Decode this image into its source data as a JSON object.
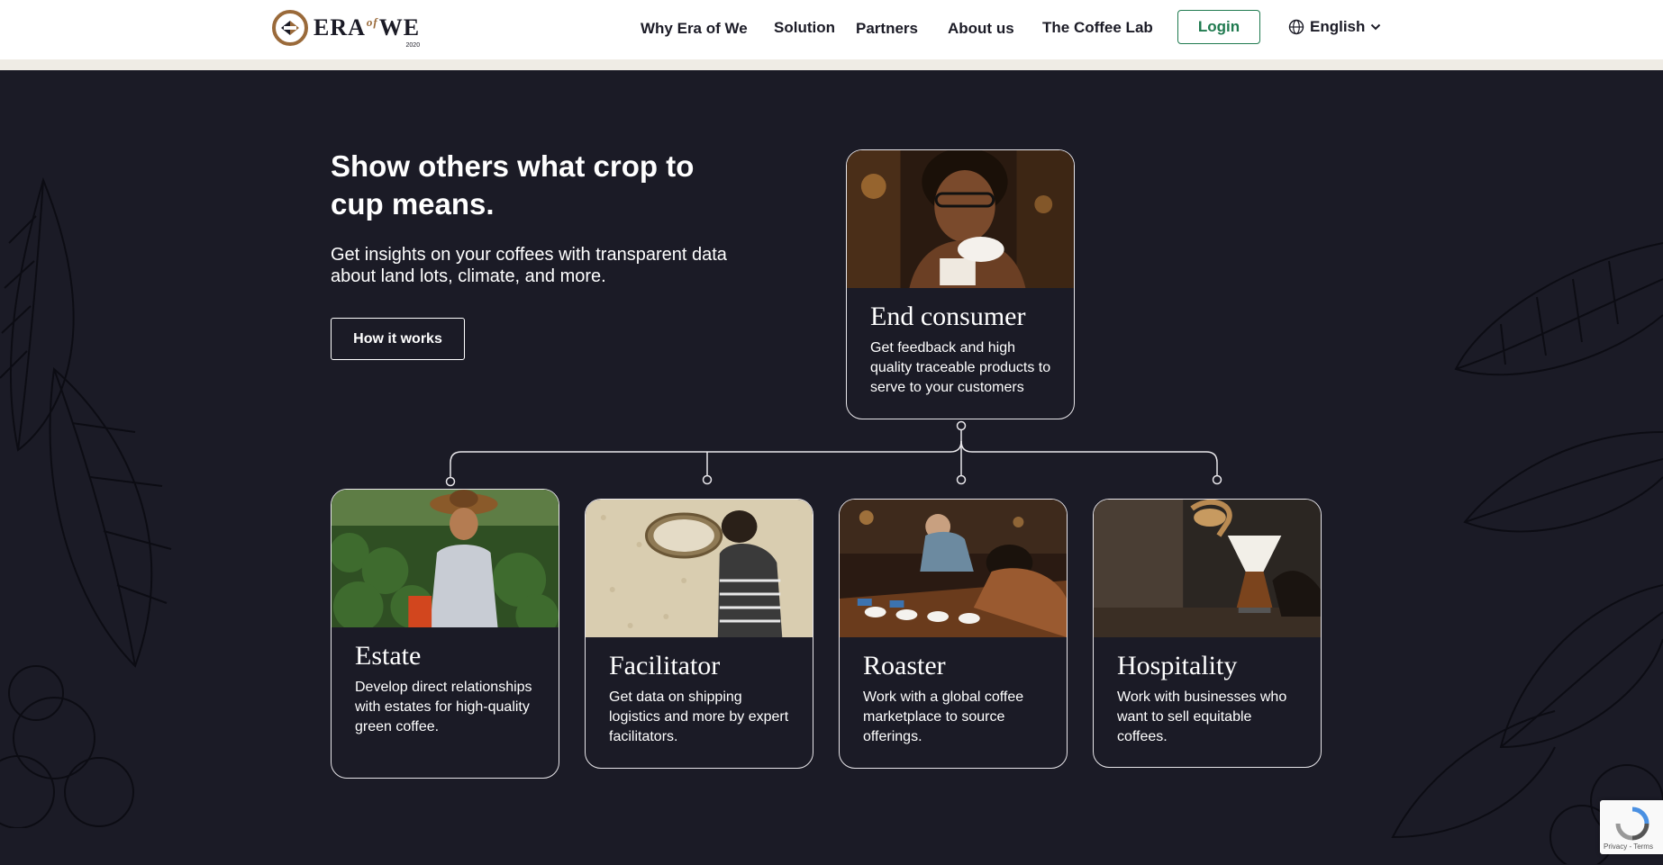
{
  "header": {
    "logo": {
      "main": "ERA",
      "of": "of",
      "we": "WE",
      "year": "2020"
    },
    "nav": [
      "Why Era of We",
      "Solution",
      "Partners",
      "About us",
      "The Coffee Lab"
    ],
    "login_label": "Login",
    "language": "English"
  },
  "hero": {
    "title": "Show others what crop to cup means.",
    "subtitle": "Get insights on your coffees with transparent data about land lots, climate, and more.",
    "button_label": "How it works"
  },
  "cards": {
    "end_consumer": {
      "title": "End consumer",
      "desc": "Get feedback and high quality traceable products to serve to your customers",
      "photo": "woman-with-coffee-cup-photo"
    },
    "estate": {
      "title": "Estate",
      "desc": "Develop direct relationships with estates for high-quality green coffee.",
      "photo": "coffee-farmer-photo"
    },
    "facilitator": {
      "title": "Facilitator",
      "desc": "Get data on shipping logistics and more by expert facilitators.",
      "photo": "drying-coffee-beans-photo"
    },
    "roaster": {
      "title": "Roaster",
      "desc": "Work with a global coffee marketplace to source offerings.",
      "photo": "coffee-cupping-photo"
    },
    "hospitality": {
      "title": "Hospitality",
      "desc": "Work with businesses who want to sell equitable coffees.",
      "photo": "pour-over-coffee-photo"
    }
  },
  "recaptcha": {
    "terms": "Privacy - Terms"
  },
  "colors": {
    "background": "#1b1b26",
    "accent_green": "#1f7a4f",
    "logo_brown": "#9a6a3a"
  }
}
